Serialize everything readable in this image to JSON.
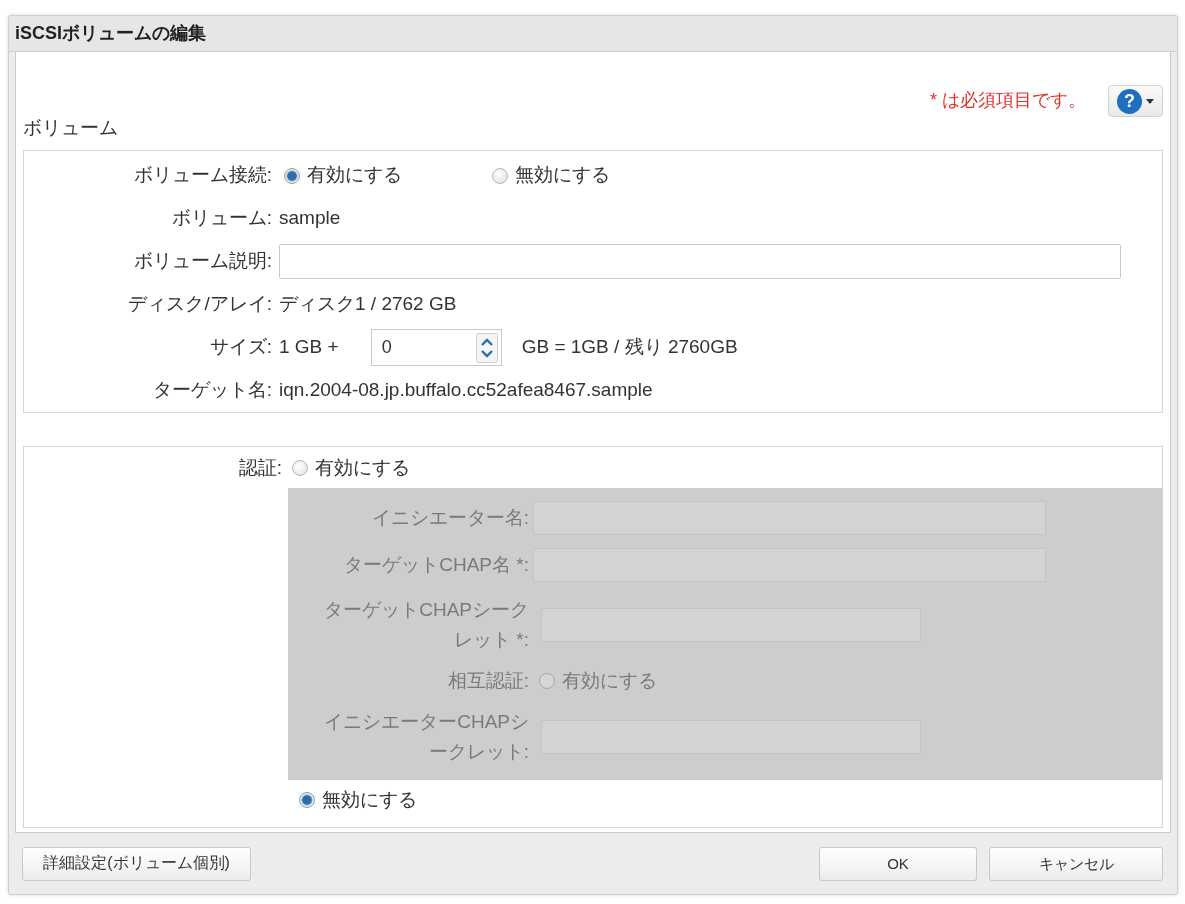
{
  "window": {
    "title": "iSCSIボリュームの編集"
  },
  "required_note": "* は必須項目です。",
  "help_button": {
    "label": "?"
  },
  "volume_section": {
    "heading": "ボリューム",
    "fields": [
      {
        "kind": "radio",
        "label": "ボリューム接続:",
        "options": [
          {
            "label": "有効にする",
            "selected": true
          },
          {
            "label": "無効にする",
            "selected": false
          }
        ]
      },
      {
        "kind": "text",
        "label": "ボリューム:",
        "value": "sample"
      },
      {
        "kind": "input",
        "label": "ボリューム説明:"
      },
      {
        "kind": "text",
        "label": "ディスク/アレイ:",
        "value": "ディスク1 / 2762 GB"
      },
      {
        "kind": "spinner",
        "label": "サイズ:",
        "prefix": "1 GB +",
        "value": "0",
        "suffix": "GB = 1GB / 残り 2760GB"
      },
      {
        "kind": "text",
        "label": "ターゲット名:",
        "value": "iqn.2004-08.jp.buffalo.cc52afea8467.sample"
      }
    ]
  },
  "auth_section": {
    "label": "認証:",
    "enable_option": {
      "label": "有効にする",
      "selected": false
    },
    "disable_option": {
      "label": "無効にする",
      "selected": true
    },
    "chap_panel": {
      "disabled": true,
      "fields": [
        {
          "kind": "input",
          "label": "イニシエーター名:"
        },
        {
          "kind": "input",
          "label": "ターゲットCHAP名 *:"
        },
        {
          "kind": "password",
          "label": "ターゲットCHAPシークレット *:"
        },
        {
          "kind": "radio",
          "label": "相互認証:",
          "options": [
            {
              "label": "有効にする",
              "selected": false
            }
          ]
        },
        {
          "kind": "password",
          "label": "イニシエーターCHAPシークレット:"
        }
      ]
    }
  },
  "footer": {
    "advanced_button": "詳細設定(ボリューム個別)",
    "ok_button": "OK",
    "cancel_button": "キャンセル"
  }
}
